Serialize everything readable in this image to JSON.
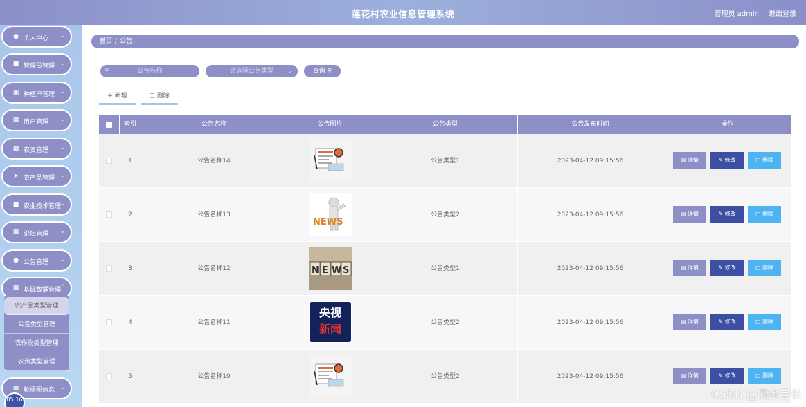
{
  "header": {
    "title": "莲花村农业信息管理系统",
    "admin_label": "管理员 admin",
    "logout_label": "退出登录"
  },
  "sidebar": {
    "items": [
      {
        "label": "个人中心",
        "icon": "user-icon"
      },
      {
        "label": "管理员管理",
        "icon": "admin-icon"
      },
      {
        "label": "种植户管理",
        "icon": "grower-icon"
      },
      {
        "label": "用户管理",
        "icon": "grid-icon"
      },
      {
        "label": "农资管理",
        "icon": "briefcase-icon"
      },
      {
        "label": "农产品管理",
        "icon": "send-icon"
      },
      {
        "label": "农业技术管理",
        "icon": "book-icon"
      },
      {
        "label": "论坛管理",
        "icon": "grid-icon"
      },
      {
        "label": "公告管理",
        "icon": "user-icon"
      },
      {
        "label": "基础数据管理",
        "icon": "grid-icon"
      },
      {
        "label": "轮播图信息",
        "icon": "grid-icon"
      }
    ],
    "submenu": [
      {
        "label": "农产品类型管理"
      },
      {
        "label": "公告类型管理"
      },
      {
        "label": "农作物类型管理"
      },
      {
        "label": "农资类型管理"
      }
    ],
    "clock": "05:16"
  },
  "breadcrumb": {
    "home": "首页",
    "separator": "/",
    "current": "公告"
  },
  "search": {
    "name_placeholder": "公告名称",
    "type_placeholder": "请选择公告类型",
    "query_label": "查询"
  },
  "actions": {
    "add_label": "新增",
    "delete_label": "删除"
  },
  "table": {
    "columns": [
      "索引",
      "公告名称",
      "公告图片",
      "公告类型",
      "公告发布时间",
      "操作"
    ],
    "rows": [
      {
        "index": "1",
        "name": "公告名称14",
        "type": "公告类型1",
        "time": "2023-04-12 09:15:56",
        "image": "news-paper"
      },
      {
        "index": "2",
        "name": "公告名称13",
        "type": "公告类型2",
        "time": "2023-04-12 09:15:56",
        "image": "news-figure"
      },
      {
        "index": "3",
        "name": "公告名称12",
        "type": "公告类型1",
        "time": "2023-04-12 09:15:56",
        "image": "news-blocks"
      },
      {
        "index": "4",
        "name": "公告名称11",
        "type": "公告类型2",
        "time": "2023-04-12 09:15:56",
        "image": "cctv-news"
      },
      {
        "index": "5",
        "name": "公告名称10",
        "type": "公告类型2",
        "time": "2023-04-12 09:15:56",
        "image": "news-paper"
      }
    ],
    "op_labels": {
      "detail": "详情",
      "edit": "修改",
      "delete": "删除"
    },
    "cctv_text": [
      "央视",
      "新闻"
    ]
  },
  "watermark": "CSDN @四金学长",
  "colors": {
    "accent": "#8d8fc6",
    "edit": "#3d4fa2",
    "delete": "#4eb3f1"
  }
}
